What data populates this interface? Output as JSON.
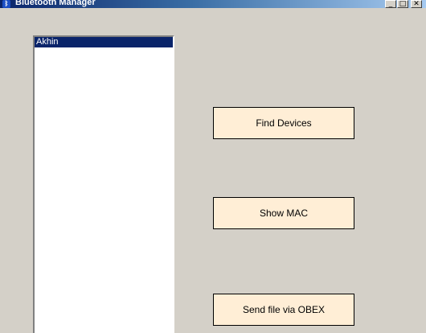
{
  "window": {
    "title": "Bluetooth Manager",
    "icon": "bluetooth-icon",
    "controls": {
      "minimize_glyph": "_",
      "maximize_glyph": "□",
      "close_glyph": "✕"
    }
  },
  "device_list": {
    "items": [
      {
        "label": "Akhin",
        "selected": true
      }
    ]
  },
  "buttons": {
    "find_devices": "Find Devices",
    "show_mac": "Show MAC",
    "send_obex": "Send file via OBEX"
  },
  "colors": {
    "selection": "#0a246a",
    "button_face": "#ffeed6",
    "window_bg": "#d4d0c8"
  }
}
